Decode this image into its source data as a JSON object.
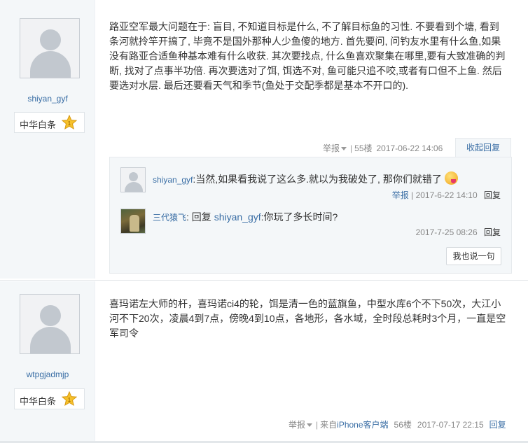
{
  "posts": [
    {
      "username": "shiyan_gyf",
      "badge": "中华白条",
      "content": "路亚空军最大问题在于: 盲目, 不知道目标是什么, 不了解目标鱼的习性. 不要看到个塘, 看到条河就拎竿开搞了, 毕竟不是国外那种人少鱼傻的地方. 首先要问, 问钓友水里有什么鱼,如果没有路亚合适鱼种基本难有什么收获. 其次要找点, 什么鱼喜欢聚集在哪里,要有大致准确的判断, 找对了点事半功倍. 再次要选对了饵, 饵选不对, 鱼可能只追不咬,或者有口但不上鱼. 然后要选对水层. 最后还要看天气和季节(鱼处于交配季都是基本不开口的).",
      "report": "举报",
      "floor": "55楼",
      "time": "2017-06-22 14:06",
      "collapse_label": "收起回复",
      "replies": [
        {
          "name": "shiyan_gyf",
          "text": "当然,如果看我说了这么多.就以为我破处了, 那你们就错了",
          "report": "举报",
          "time": "2017-6-22 14:10",
          "reply_label": "回复"
        },
        {
          "name": "三代猿飞",
          "prefix": "回复",
          "target": "shiyan_gyf",
          "text": ":你玩了多长时间?",
          "time": "2017-7-25 08:26",
          "reply_label": "回复"
        }
      ],
      "say_button": "我也说一句"
    },
    {
      "username": "wtpgjadmjp",
      "badge": "中华白条",
      "content": "喜玛诺左大师的杆，喜玛诺ci4的轮，饵是清一色的蓝旗鱼，中型水库6个不下50次，大江小河不下20次，凌晨4到7点，傍晚4到10点，各地形，各水域，全时段总耗时3个月，一直是空军司令",
      "report": "举报",
      "source_prefix": "来自",
      "source": "iPhone客户端",
      "floor": "56楼",
      "time": "2017-07-17 22:15",
      "reply_label": "回复"
    }
  ]
}
